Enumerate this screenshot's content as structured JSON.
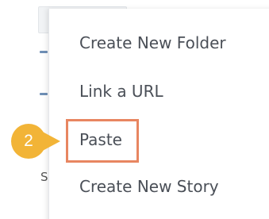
{
  "menu": {
    "items": [
      {
        "label": "Create New Folder"
      },
      {
        "label": "Link a URL"
      },
      {
        "label": "Paste"
      },
      {
        "label": "Create New Story"
      }
    ]
  },
  "callout": {
    "step_number": "2",
    "color": "#f2b437",
    "highlight_color": "#e88661"
  },
  "background": {
    "partial_letter": "S"
  }
}
